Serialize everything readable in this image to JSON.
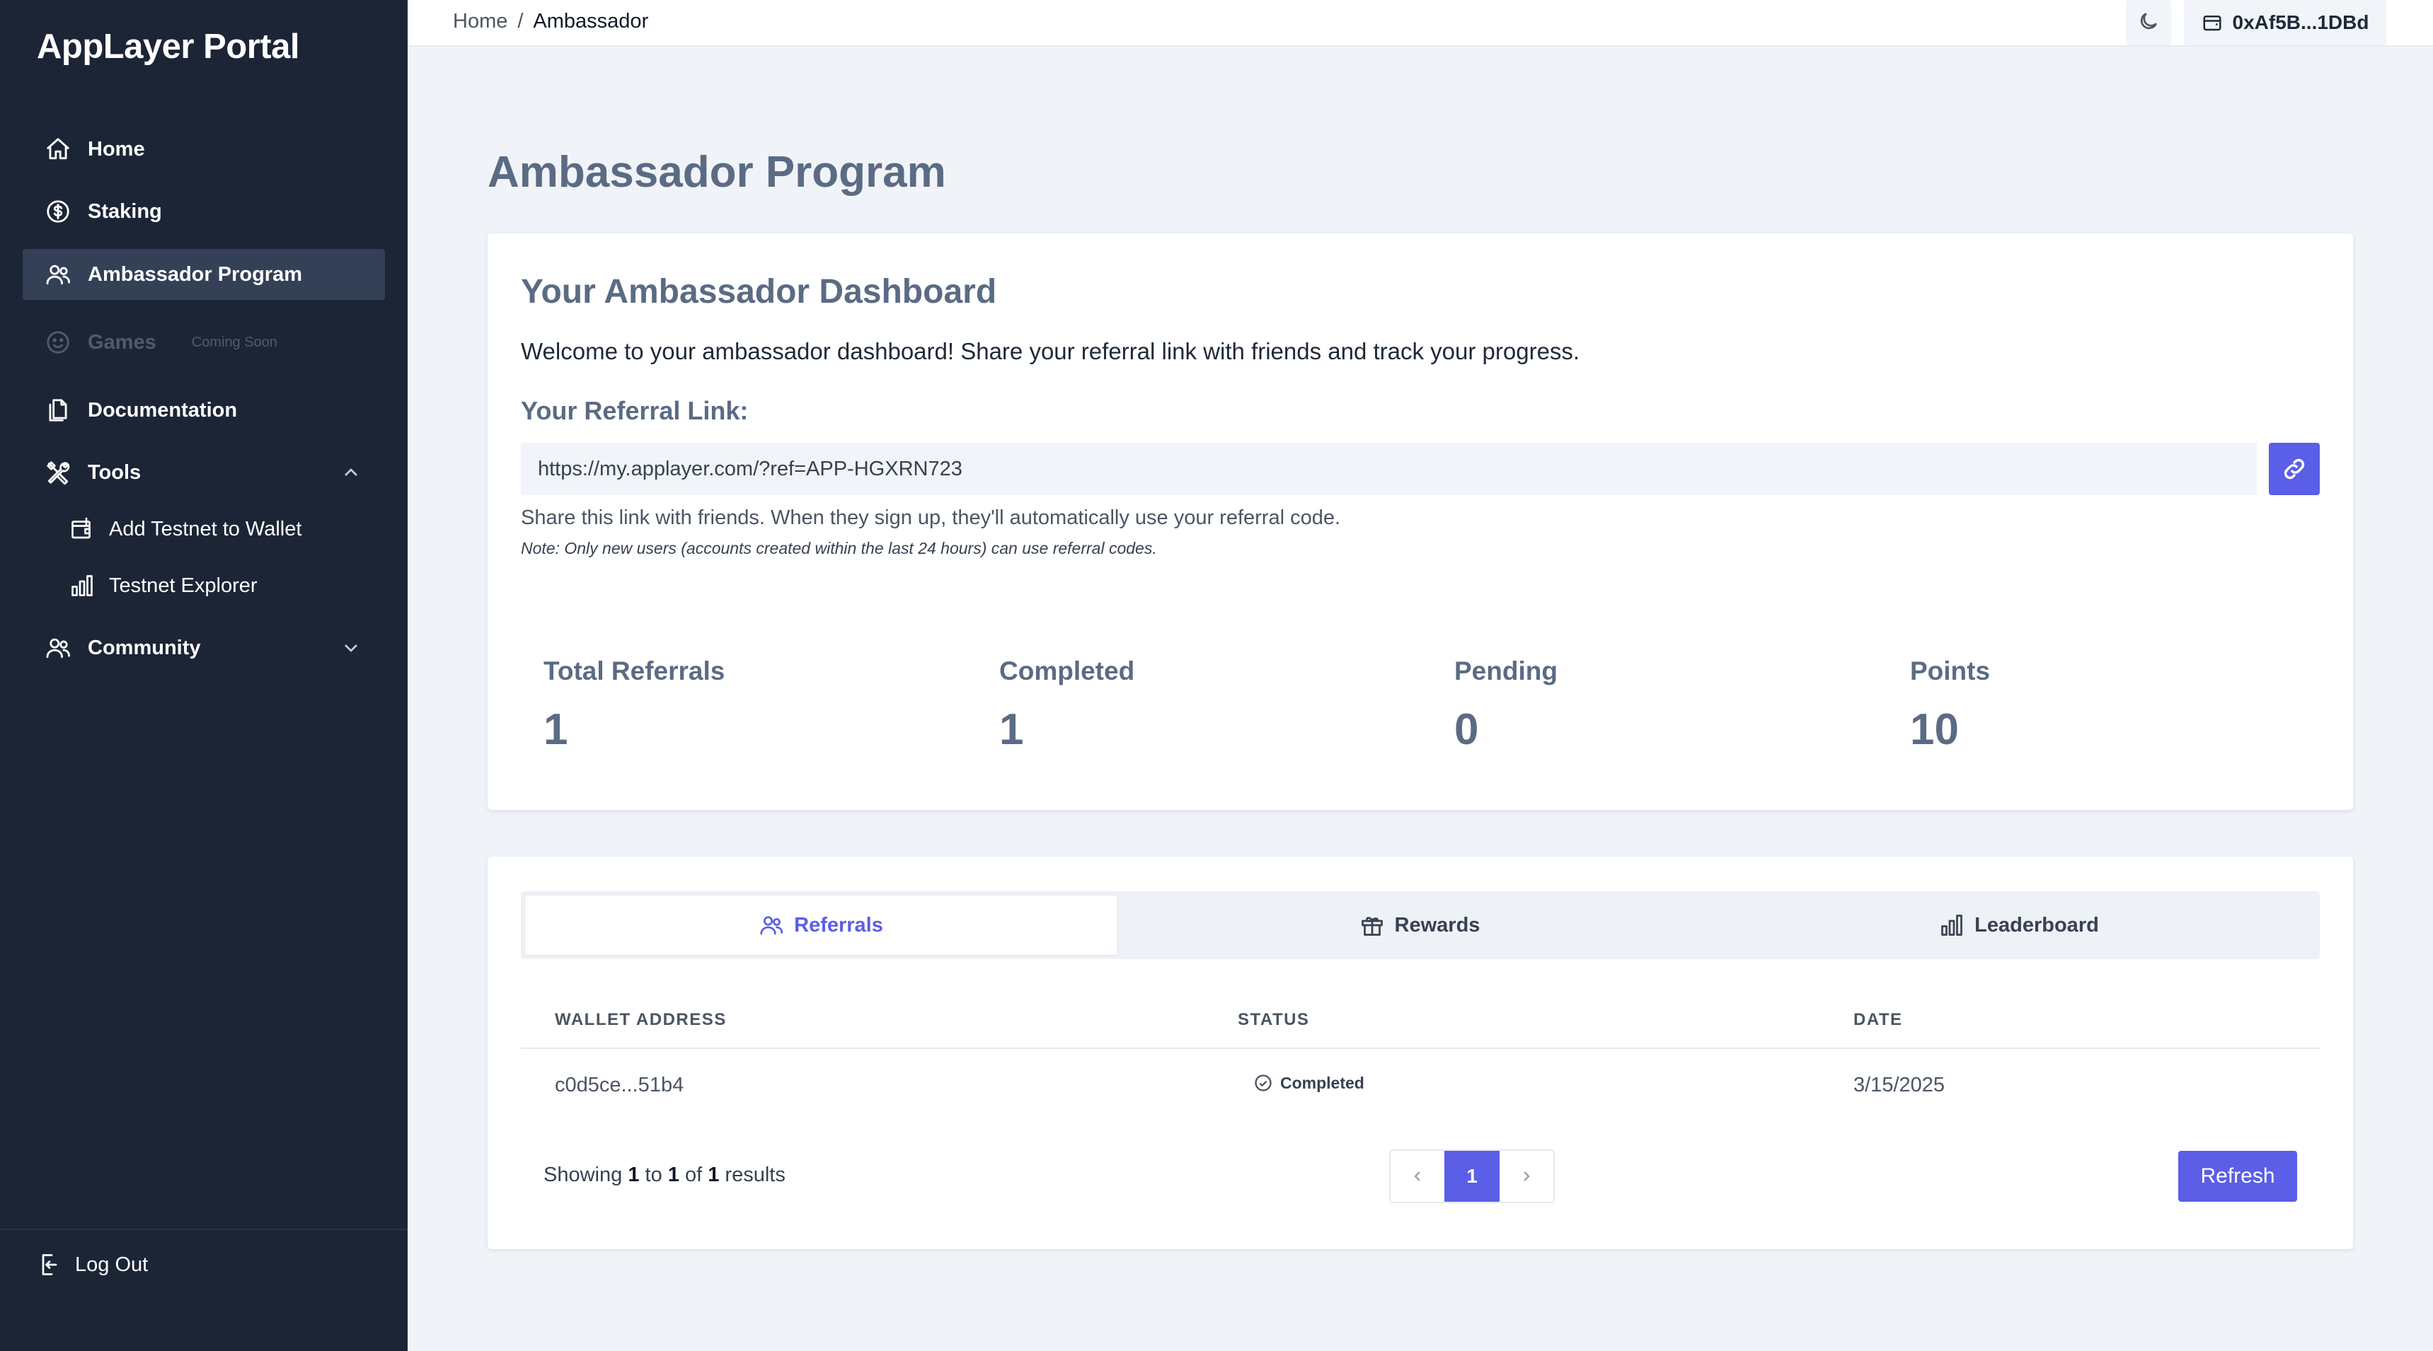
{
  "app": {
    "logo": "AppLayer Portal"
  },
  "sidebar": {
    "items": [
      {
        "label": "Home",
        "icon": "home-icon"
      },
      {
        "label": "Staking",
        "icon": "dollar-circle-icon"
      },
      {
        "label": "Ambassador Program",
        "icon": "users-icon",
        "active": true
      },
      {
        "label": "Games",
        "icon": "smile-icon",
        "badge": "Coming Soon",
        "disabled": true
      },
      {
        "label": "Documentation",
        "icon": "documents-icon"
      },
      {
        "label": "Tools",
        "icon": "tools-icon",
        "expanded": true
      },
      {
        "label": "Community",
        "icon": "users-icon",
        "expanded": false
      }
    ],
    "tools_sub": [
      {
        "label": "Add Testnet to Wallet",
        "icon": "wallet-plus-icon"
      },
      {
        "label": "Testnet Explorer",
        "icon": "bar-chart-icon"
      }
    ],
    "logout": "Log Out"
  },
  "topbar": {
    "breadcrumb": {
      "home": "Home",
      "separator": "/",
      "current": "Ambassador"
    },
    "wallet": "0xAf5B...1DBd"
  },
  "page": {
    "title": "Ambassador Program"
  },
  "dashboard": {
    "title": "Your Ambassador Dashboard",
    "welcome": "Welcome to your ambassador dashboard! Share your referral link with friends and track your progress.",
    "referral_label": "Your Referral Link:",
    "referral_link": "https://my.applayer.com/?ref=APP-HGXRN723",
    "share_note": "Share this link with friends. When they sign up, they'll automatically use your referral code.",
    "small_note": "Note: Only new users (accounts created within the last 24 hours) can use referral codes.",
    "stats": [
      {
        "label": "Total Referrals",
        "value": "1"
      },
      {
        "label": "Completed",
        "value": "1"
      },
      {
        "label": "Pending",
        "value": "0"
      },
      {
        "label": "Points",
        "value": "10"
      }
    ]
  },
  "tabs": [
    {
      "label": "Referrals",
      "icon": "users-icon",
      "active": true
    },
    {
      "label": "Rewards",
      "icon": "gift-icon"
    },
    {
      "label": "Leaderboard",
      "icon": "bar-chart-icon"
    }
  ],
  "table": {
    "headers": [
      "WALLET ADDRESS",
      "STATUS",
      "DATE"
    ],
    "rows": [
      {
        "wallet": "c0d5ce...51b4",
        "status": "Completed",
        "date": "3/15/2025"
      }
    ]
  },
  "pagination": {
    "showing_prefix": "Showing",
    "from": "1",
    "to_word": "to",
    "to": "1",
    "of_word": "of",
    "total": "1",
    "results_word": "results",
    "current_page": "1"
  },
  "refresh_label": "Refresh",
  "colors": {
    "sidebar_bg": "#1c2536",
    "accent": "#5b5ee6",
    "page_bg": "#f0f3f8"
  }
}
